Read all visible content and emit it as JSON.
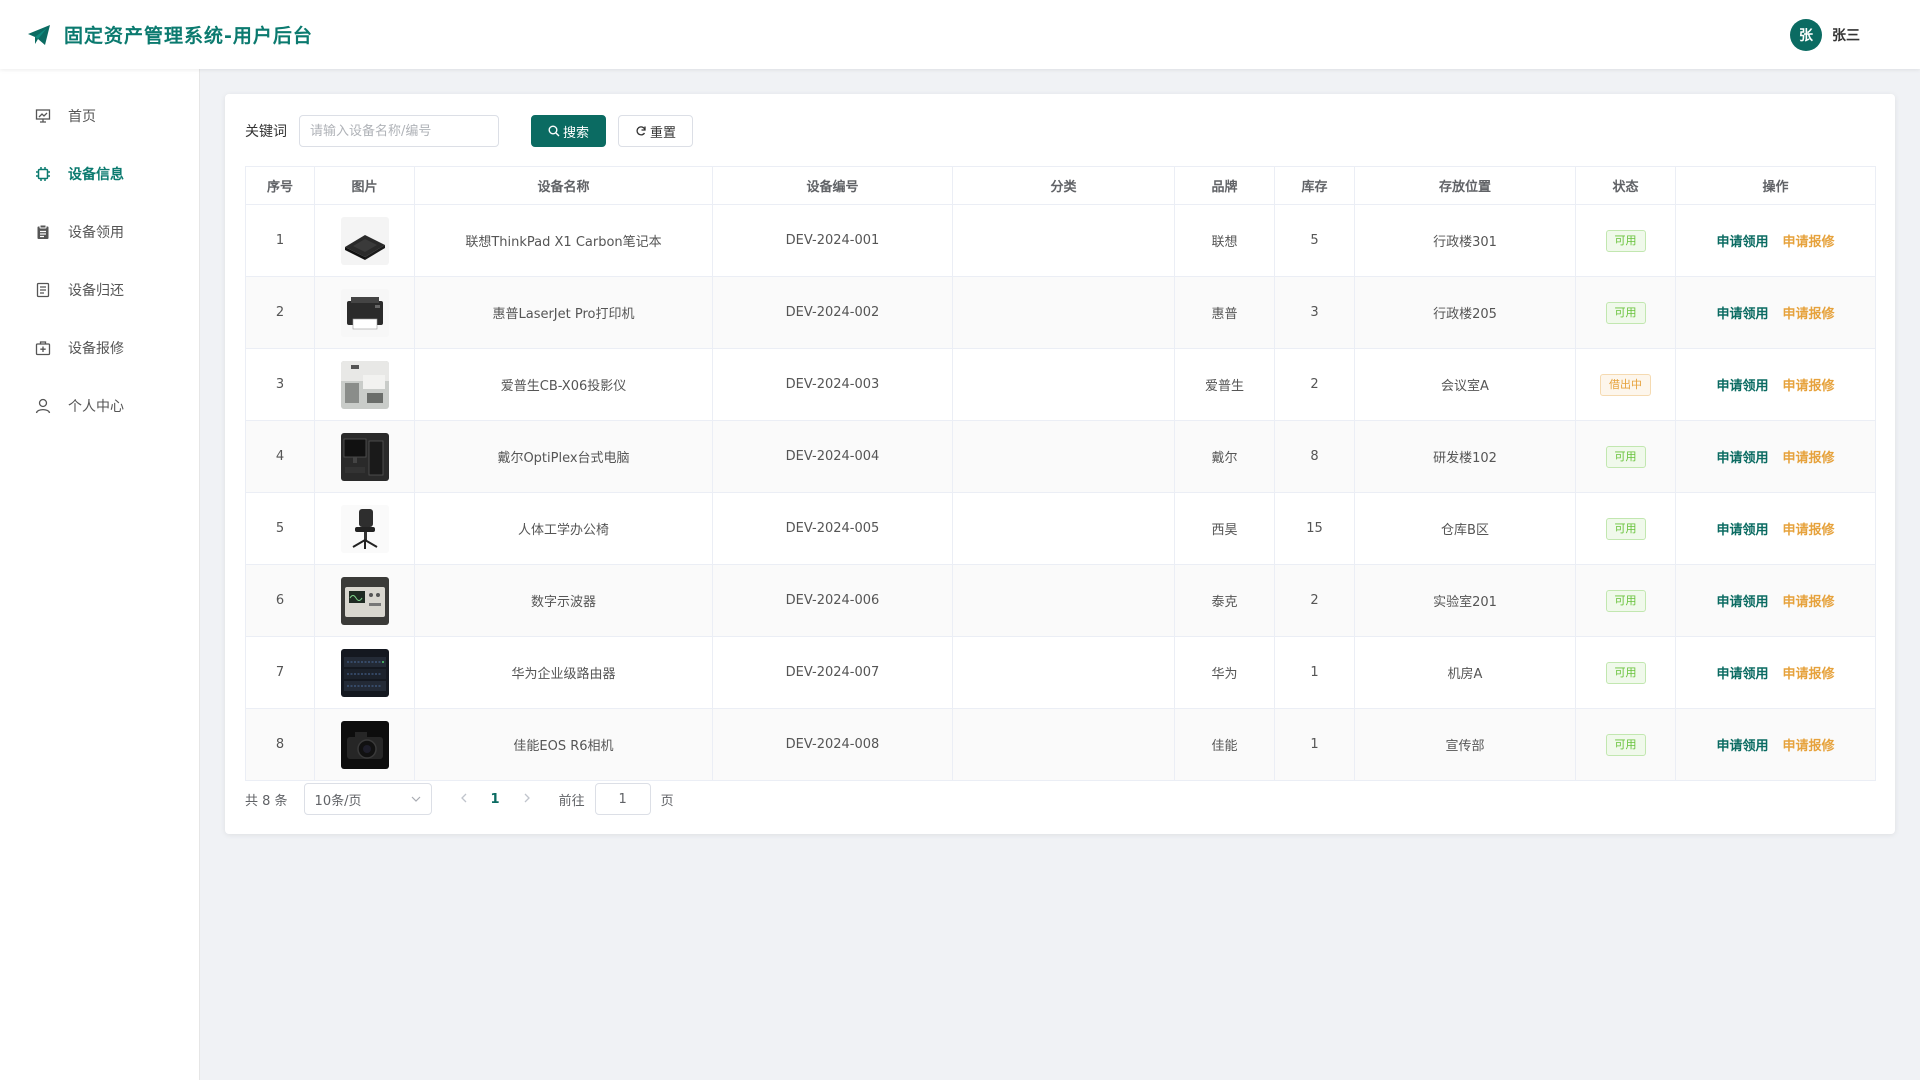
{
  "header": {
    "title": "固定资产管理系统-用户后台",
    "avatar_text": "张",
    "user_name": "张三"
  },
  "sidebar": {
    "items": [
      {
        "label": "首页",
        "icon": "presentation-icon",
        "active": false
      },
      {
        "label": "设备信息",
        "icon": "chip-icon",
        "active": true
      },
      {
        "label": "设备领用",
        "icon": "clipboard-icon",
        "active": false
      },
      {
        "label": "设备归还",
        "icon": "document-icon",
        "active": false
      },
      {
        "label": "设备报修",
        "icon": "medical-kit-icon",
        "active": false
      },
      {
        "label": "个人中心",
        "icon": "user-icon",
        "active": false
      }
    ]
  },
  "search": {
    "label": "关键词",
    "placeholder": "请输入设备名称/编号",
    "value": "",
    "search_label": "搜索",
    "reset_label": "重置"
  },
  "table": {
    "headers": [
      "序号",
      "图片",
      "设备名称",
      "设备编号",
      "分类",
      "品牌",
      "库存",
      "存放位置",
      "状态",
      "操作"
    ],
    "rows": [
      {
        "no": "1",
        "name": "联想ThinkPad X1 Carbon笔记本",
        "code": "DEV-2024-001",
        "category": "",
        "brand": "联想",
        "stock": "5",
        "location": "行政楼301",
        "status": "可用",
        "status_type": "ok"
      },
      {
        "no": "2",
        "name": "惠普LaserJet Pro打印机",
        "code": "DEV-2024-002",
        "category": "",
        "brand": "惠普",
        "stock": "3",
        "location": "行政楼205",
        "status": "可用",
        "status_type": "ok"
      },
      {
        "no": "3",
        "name": "爱普生CB-X06投影仪",
        "code": "DEV-2024-003",
        "category": "",
        "brand": "爱普生",
        "stock": "2",
        "location": "会议室A",
        "status": "借出中",
        "status_type": "warn"
      },
      {
        "no": "4",
        "name": "戴尔OptiPlex台式电脑",
        "code": "DEV-2024-004",
        "category": "",
        "brand": "戴尔",
        "stock": "8",
        "location": "研发楼102",
        "status": "可用",
        "status_type": "ok"
      },
      {
        "no": "5",
        "name": "人体工学办公椅",
        "code": "DEV-2024-005",
        "category": "",
        "brand": "西昊",
        "stock": "15",
        "location": "仓库B区",
        "status": "可用",
        "status_type": "ok"
      },
      {
        "no": "6",
        "name": "数字示波器",
        "code": "DEV-2024-006",
        "category": "",
        "brand": "泰克",
        "stock": "2",
        "location": "实验室201",
        "status": "可用",
        "status_type": "ok"
      },
      {
        "no": "7",
        "name": "华为企业级路由器",
        "code": "DEV-2024-007",
        "category": "",
        "brand": "华为",
        "stock": "1",
        "location": "机房A",
        "status": "可用",
        "status_type": "ok"
      },
      {
        "no": "8",
        "name": "佳能EOS R6相机",
        "code": "DEV-2024-008",
        "category": "",
        "brand": "佳能",
        "stock": "1",
        "location": "宣传部",
        "status": "可用",
        "status_type": "ok"
      }
    ],
    "apply_label": "申请领用",
    "repair_label": "申请报修"
  },
  "pagination": {
    "total_text": "共 8 条",
    "page_size": "10条/页",
    "current_page": "1",
    "goto_label": "前往",
    "goto_value": "1",
    "page_unit": "页"
  },
  "colors": {
    "brand": "#0b6b62",
    "warning": "#e6a23c",
    "success": "#67c23a"
  }
}
